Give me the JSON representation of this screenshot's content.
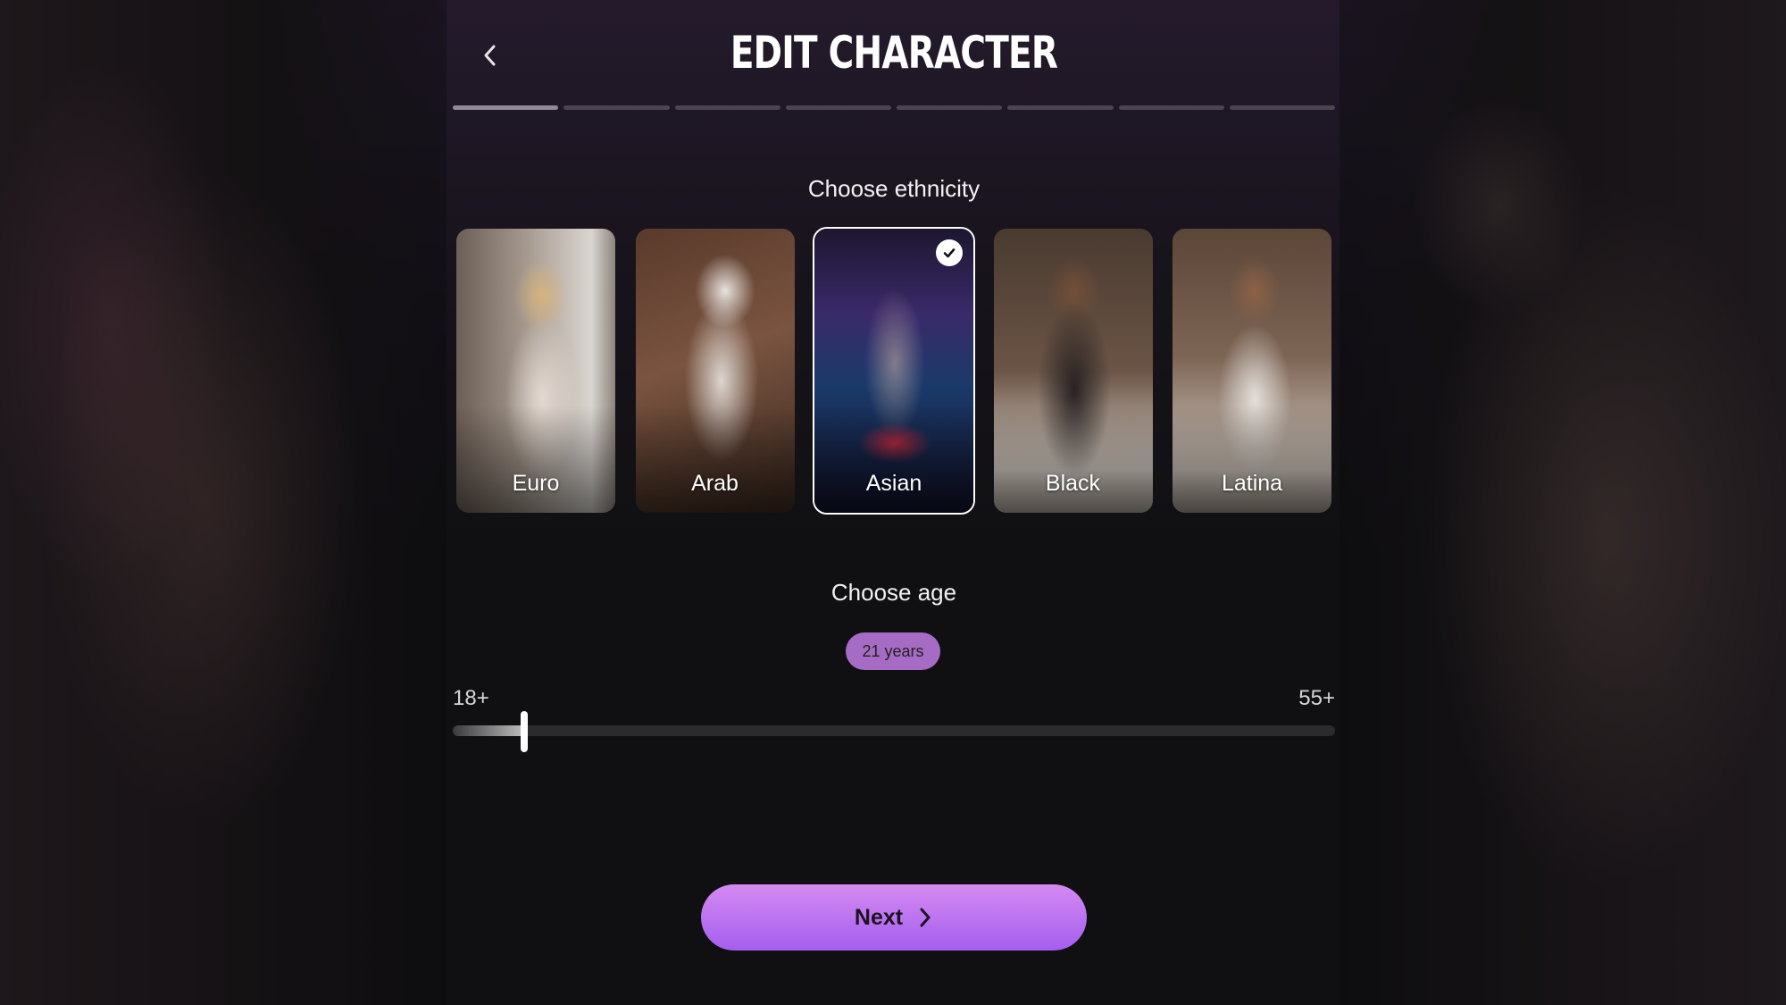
{
  "header": {
    "title": "EDIT CHARACTER",
    "back_icon": "chevron-left-icon"
  },
  "progress": {
    "total_steps": 8,
    "current_step": 1
  },
  "ethnicity": {
    "title": "Choose ethnicity",
    "options": [
      {
        "label": "Euro",
        "selected": false
      },
      {
        "label": "Arab",
        "selected": false
      },
      {
        "label": "Asian",
        "selected": true
      },
      {
        "label": "Black",
        "selected": false
      },
      {
        "label": "Latina",
        "selected": false
      }
    ],
    "selected_icon": "checkmark-icon"
  },
  "age": {
    "title": "Choose age",
    "value_label": "21 years",
    "min_label": "18+",
    "max_label": "55+",
    "value": 21,
    "min": 18,
    "max": 55
  },
  "footer": {
    "next_label": "Next",
    "next_icon": "chevron-right-icon"
  },
  "colors": {
    "accent": "#a66bc4",
    "button_gradient_top": "#d48af0",
    "button_gradient_bottom": "#a55ef0",
    "background": "#101012"
  }
}
